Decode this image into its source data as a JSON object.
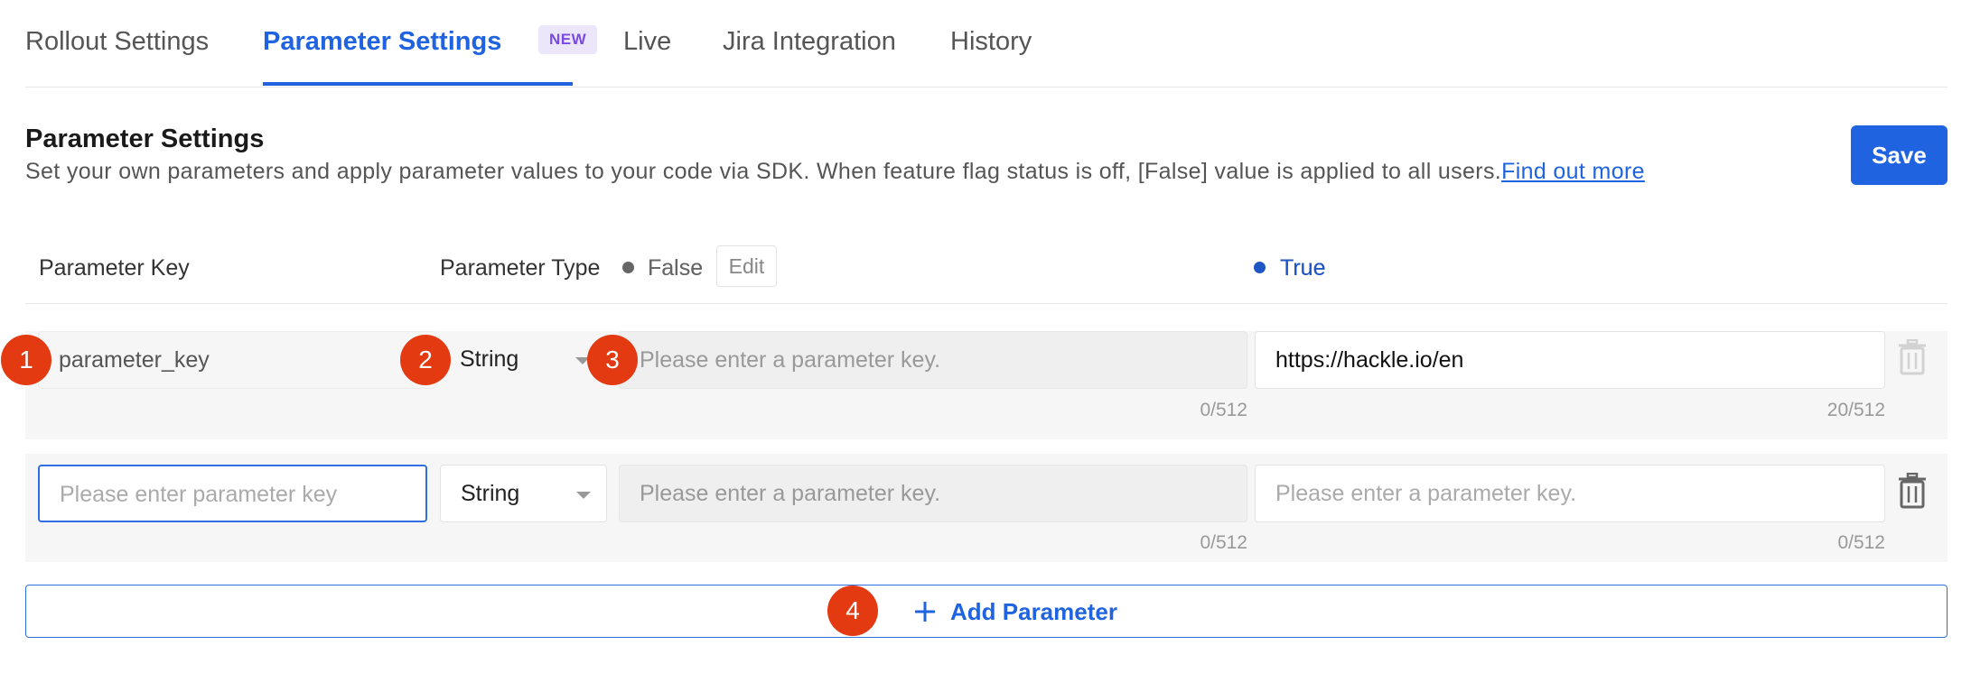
{
  "tabs": [
    {
      "label": "Rollout Settings"
    },
    {
      "label": "Parameter Settings",
      "badge": "NEW"
    },
    {
      "label": "Live"
    },
    {
      "label": "Jira Integration"
    },
    {
      "label": "History"
    }
  ],
  "header": {
    "title": "Parameter Settings",
    "description": "Set your own parameters and apply parameter values to your code via SDK. When feature flag status is off, [False] value is applied to all users.",
    "link": "Find out more",
    "save_label": "Save"
  },
  "columns": {
    "key": "Parameter Key",
    "type": "Parameter Type",
    "false_label": "False",
    "edit_label": "Edit",
    "true_label": "True"
  },
  "rows": [
    {
      "key_value": "parameter_key",
      "type_value": "String",
      "false_placeholder": "Please enter a parameter key.",
      "false_counter": "0/512",
      "true_value": "https://hackle.io/en",
      "true_counter": "20/512"
    },
    {
      "key_placeholder": "Please enter parameter key",
      "type_value": "String",
      "false_placeholder": "Please enter a parameter key.",
      "false_counter": "0/512",
      "true_placeholder": "Please enter a parameter key.",
      "true_counter": "0/512"
    }
  ],
  "add_parameter_label": "Add Parameter",
  "markers": [
    "1",
    "2",
    "3",
    "4"
  ],
  "colors": {
    "accent": "#1f63e0",
    "marker": "#e33a12",
    "false_dot": "#666666",
    "true_dot": "#1f55c4",
    "badge_bg": "#ece6fb",
    "badge_text": "#7a4be0"
  }
}
